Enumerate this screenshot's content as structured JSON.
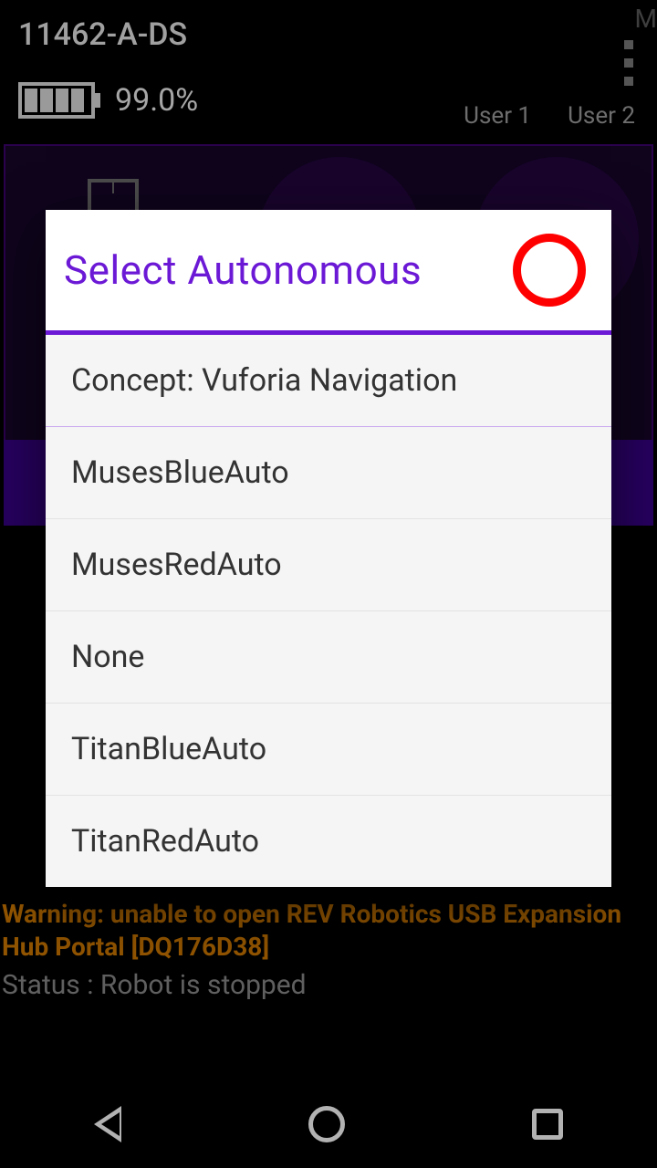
{
  "header": {
    "title": "11462-A-DS",
    "battery_pct": "99.0%",
    "users": [
      "User 1",
      "User 2"
    ],
    "corner_glyph": "M"
  },
  "warning_text": "Warning: unable to open REV Robotics USB Expansion Hub Portal [DQ176D38]",
  "status_text": "Status : Robot is stopped",
  "dialog": {
    "title": "Select Autonomous",
    "items": [
      "Concept: Vuforia Navigation",
      "MusesBlueAuto",
      "MusesRedAuto",
      "None",
      "TitanBlueAuto",
      "TitanRedAuto"
    ]
  }
}
